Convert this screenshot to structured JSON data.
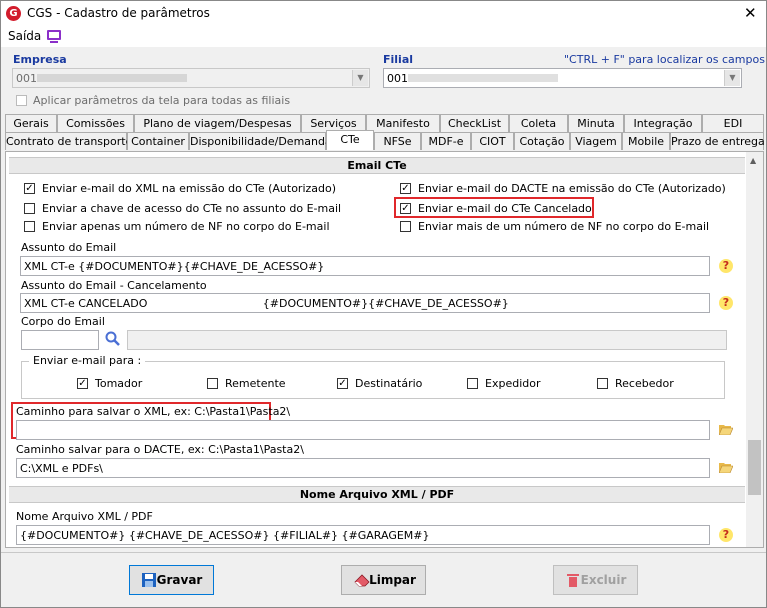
{
  "window": {
    "title": "CGS - Cadastro de parâmetros"
  },
  "menu": {
    "saida": "Saída"
  },
  "empresa": {
    "label": "Empresa",
    "value": "001"
  },
  "filial": {
    "label": "Filial",
    "value": "001",
    "hint": "\"CTRL + F\" para localizar os campos"
  },
  "aplicar": "Aplicar parâmetros da tela para todas as filiais",
  "tabs_row1": [
    "Gerais",
    "Comissões",
    "Plano de viagem/Despesas",
    "Serviços",
    "Manifesto",
    "CheckList",
    "Coleta",
    "Minuta",
    "Integração",
    "EDI"
  ],
  "tabs_row2": [
    "Contrato de transporte",
    "Container",
    "Disponibilidade/Demanda",
    "CTe",
    "NFSe",
    "MDF-e",
    "CIOT",
    "Cotação",
    "Viagem",
    "Mobile",
    "Prazo de entrega"
  ],
  "section_email": "Email CTe",
  "checks": {
    "xml_emissao": "Enviar e-mail do XML na emissão do CTe (Autorizado)",
    "chave_assunto": "Enviar a chave de acesso do CTe no assunto do E-mail",
    "um_nf": "Enviar apenas um número de NF no corpo do E-mail",
    "dacte_emissao": "Enviar e-mail do DACTE na emissão do CTe (Autorizado)",
    "cte_cancelado": "Enviar e-mail do CTe Cancelado",
    "mais_nf": "Enviar mais de um número de NF no corpo do E-mail"
  },
  "assunto": {
    "label": "Assunto do Email",
    "value": "XML CT-e {#DOCUMENTO#}{#CHAVE_DE_ACESSO#}"
  },
  "assunto_cancel": {
    "label": "Assunto do Email - Cancelamento",
    "value": "XML CT-e CANCELADO                                 {#DOCUMENTO#}{#CHAVE_DE_ACESSO#}"
  },
  "corpo": {
    "label": "Corpo do Email"
  },
  "enviar_para": {
    "label": "Enviar e-mail para :",
    "tomador": "Tomador",
    "remetente": "Remetente",
    "destinatario": "Destinatário",
    "expedidor": "Expedidor",
    "recebedor": "Recebedor"
  },
  "caminho_xml": {
    "label": "Caminho para salvar o XML, ex: C:\\Pasta1\\Pasta2\\",
    "value": ""
  },
  "caminho_dacte": {
    "label": "Caminho salvar para o DACTE, ex: C:\\Pasta1\\Pasta2\\",
    "value": "C:\\XML e PDFs\\"
  },
  "section_nome": "Nome Arquivo XML / PDF",
  "nome_arquivo": {
    "label": "Nome Arquivo XML / PDF",
    "value": "{#DOCUMENTO#} {#CHAVE_DE_ACESSO#} {#FILIAL#} {#GARAGEM#}"
  },
  "buttons": {
    "gravar": "Gravar",
    "limpar": "Limpar",
    "excluir": "Excluir"
  },
  "colors": {
    "highlight": "#e0282b",
    "link": "#1a3aa0",
    "section_bg": "#e9e9e9"
  }
}
